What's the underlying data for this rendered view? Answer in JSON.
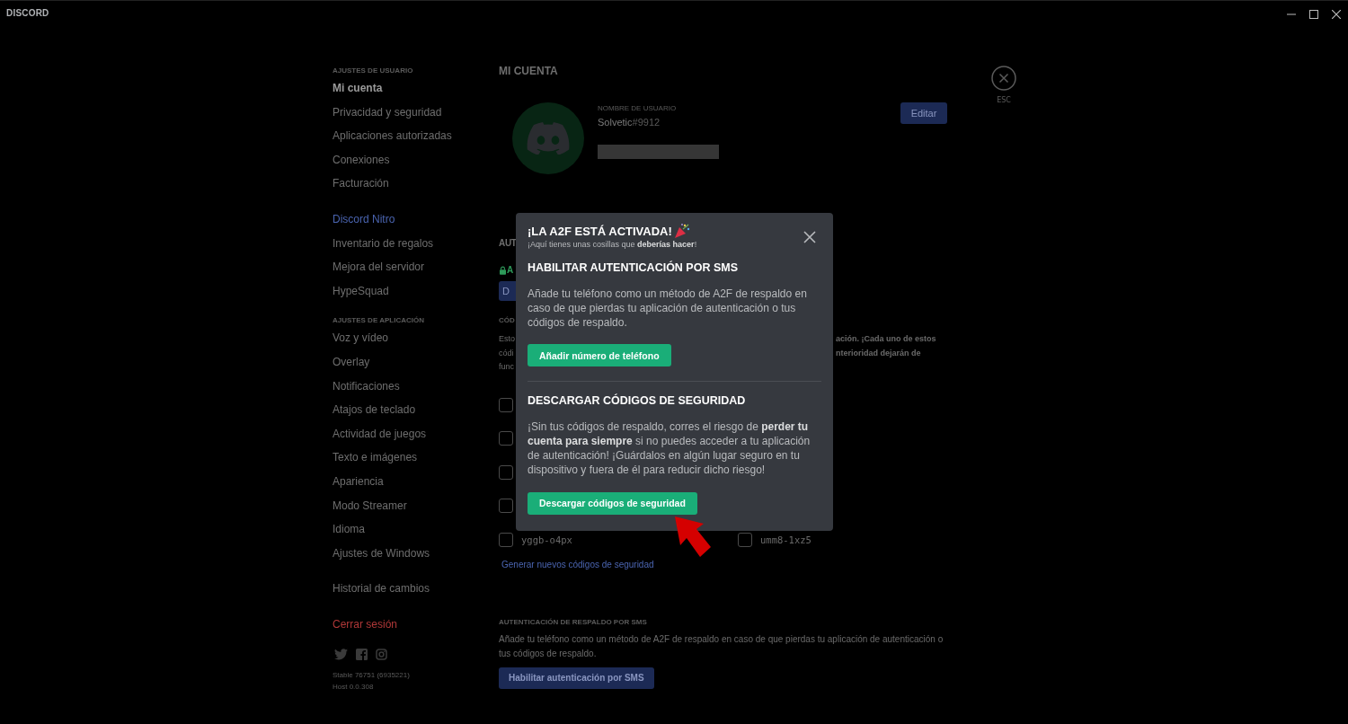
{
  "titlebar": {
    "logo": "DISCORD"
  },
  "sidebar": {
    "groups": [
      {
        "header": "AJUSTES DE USUARIO",
        "items": [
          {
            "label": "Mi cuenta",
            "kind": "normal",
            "selected": true
          },
          {
            "label": "Privacidad y seguridad",
            "kind": "normal",
            "selected": false
          },
          {
            "label": "Aplicaciones autorizadas",
            "kind": "normal",
            "selected": false
          },
          {
            "label": "Conexiones",
            "kind": "normal",
            "selected": false
          },
          {
            "label": "Facturación",
            "kind": "normal",
            "selected": false
          }
        ]
      },
      {
        "items": [
          {
            "label": "Discord Nitro",
            "kind": "nitro",
            "selected": false
          },
          {
            "label": "Inventario de regalos",
            "kind": "normal",
            "selected": false
          },
          {
            "label": "Mejora del servidor",
            "kind": "normal",
            "selected": false
          },
          {
            "label": "HypeSquad",
            "kind": "normal",
            "selected": false
          }
        ]
      },
      {
        "header": "AJUSTES DE APLICACIÓN",
        "items": [
          {
            "label": "Voz y vídeo",
            "kind": "normal",
            "selected": false
          },
          {
            "label": "Overlay",
            "kind": "normal",
            "selected": false
          },
          {
            "label": "Notificaciones",
            "kind": "normal",
            "selected": false
          },
          {
            "label": "Atajos de teclado",
            "kind": "normal",
            "selected": false
          },
          {
            "label": "Actividad de juegos",
            "kind": "normal",
            "selected": false
          },
          {
            "label": "Texto e imágenes",
            "kind": "normal",
            "selected": false
          },
          {
            "label": "Apariencia",
            "kind": "normal",
            "selected": false
          },
          {
            "label": "Modo Streamer",
            "kind": "normal",
            "selected": false
          },
          {
            "label": "Idioma",
            "kind": "normal",
            "selected": false
          },
          {
            "label": "Ajustes de Windows",
            "kind": "normal",
            "selected": false
          }
        ]
      },
      {
        "items": [
          {
            "label": "Historial de cambios",
            "kind": "normal",
            "selected": false
          }
        ]
      },
      {
        "items": [
          {
            "label": "Cerrar sesión",
            "kind": "logout",
            "selected": false
          }
        ]
      }
    ],
    "version": [
      "Stable 76751 (6935221)",
      "Host 0.0.308"
    ]
  },
  "account": {
    "title": "MI CUENTA",
    "username_label": "NOMBRE DE USUARIO",
    "username": "Solvetic",
    "discriminator": "#9912",
    "edit_button": "Editar"
  },
  "close": {
    "label": "ESC"
  },
  "two_factor": {
    "heading": "AUT",
    "status": "A",
    "button": "D",
    "codes_label": "CÓD",
    "description_left": [
      "Esto",
      "códi",
      "func"
    ],
    "description_right": [
      "ación. ¡Cada uno de estos",
      "nterioridad dejarán de"
    ],
    "codes_left": [
      {
        "checked": false
      },
      {
        "checked": false
      },
      {
        "checked": false
      },
      {
        "checked": false
      },
      {
        "checked": false,
        "code": "yggb-o4px"
      }
    ],
    "codes_right": [
      {
        "checked": false,
        "code": "umm8-1xz5"
      }
    ],
    "generate_link": "Generar nuevos códigos de seguridad"
  },
  "sms_backup": {
    "heading": "AUTENTICACIÓN DE RESPALDO POR SMS",
    "description": "Añade tu teléfono como un método de A2F de respaldo en caso de que pierdas tu aplicación de autenticación o tus códigos de respaldo.",
    "button": "Habilitar autenticación por SMS"
  },
  "modal": {
    "title": "¡LA A2F ESTÁ ACTIVADA!",
    "subtitle": "¡Aquí tienes unas cosillas que **deberías hacer**!",
    "sections": [
      {
        "heading": "HABILITAR AUTENTICACIÓN POR SMS",
        "text": "Añade tu teléfono como un método de A2F de respaldo en caso de que pierdas tu aplicación de autenticación o tus códigos de respaldo.",
        "button": "Añadir número de teléfono"
      },
      {
        "heading": "DESCARGAR CÓDIGOS DE SEGURIDAD",
        "text": "¡Sin tus códigos de respaldo, corres el riesgo de **perder tu cuenta para siempre** si no puedes acceder a tu aplicación de autenticación! ¡Guárdalos en algún lugar seguro en tu dispositivo y fuera de él para reducir dicho riesgo!",
        "button": "Descargar códigos de seguridad"
      }
    ]
  }
}
